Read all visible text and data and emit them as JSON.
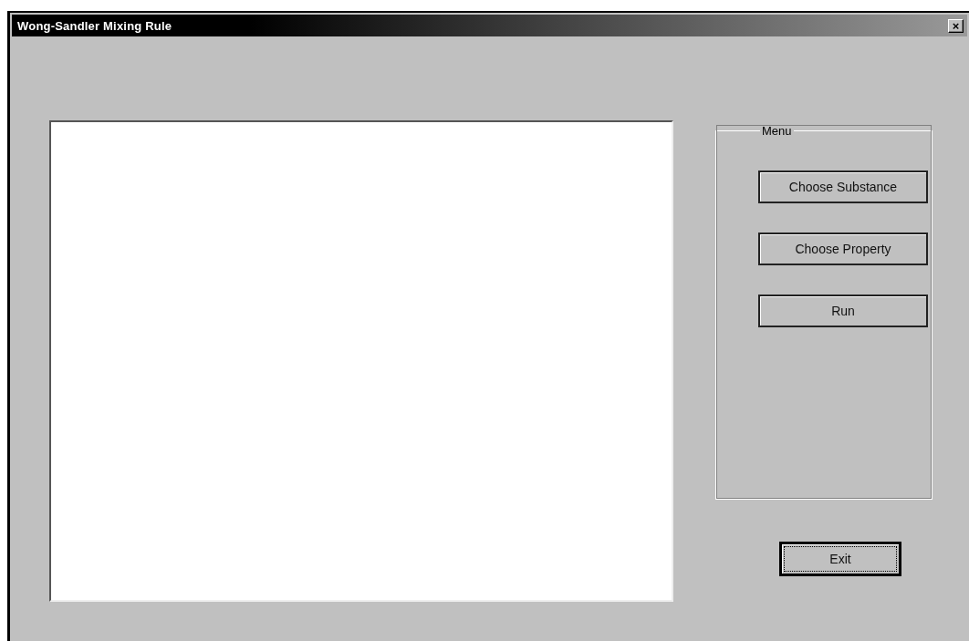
{
  "window": {
    "title": "Wong-Sandler Mixing Rule",
    "close_label": "×"
  },
  "menu": {
    "label": "Menu",
    "buttons": [
      {
        "label": "Choose Substance",
        "default": false
      },
      {
        "label": "Choose Property",
        "default": false
      },
      {
        "label": "Run",
        "default": false
      }
    ]
  },
  "exit_button": {
    "label": "Exit",
    "default": true
  }
}
